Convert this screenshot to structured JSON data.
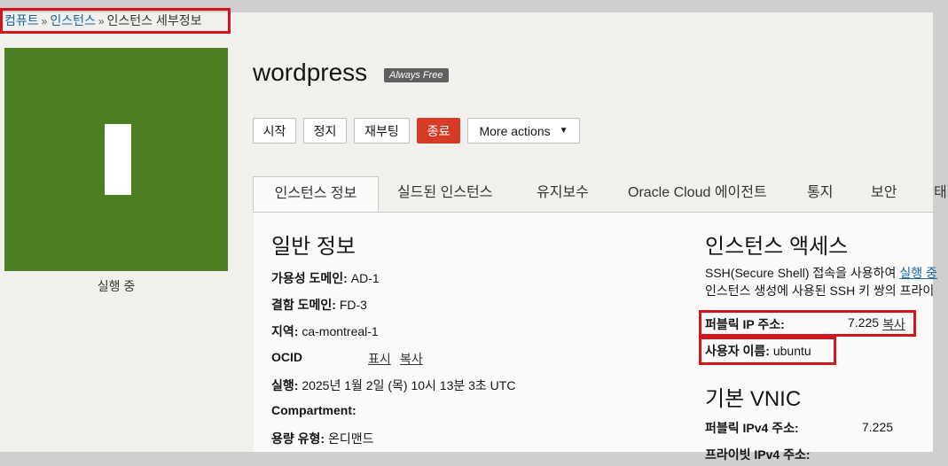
{
  "breadcrumb": {
    "compute": "컴퓨트",
    "instances": "인스턴스",
    "current": "인스턴스 세부정보",
    "separator": "»"
  },
  "status": {
    "letter": "I",
    "label": "실행 중",
    "color": "#4f7f24"
  },
  "instance": {
    "name": "wordpress",
    "badge": "Always Free"
  },
  "actions": {
    "start": "시작",
    "stop": "정지",
    "reboot": "재부팅",
    "terminate": "종료",
    "more": "More actions",
    "terminate_color": "#d63b25"
  },
  "tabs": [
    {
      "label": "인스턴스 정보",
      "active": true
    },
    {
      "label": "실드된 인스턴스",
      "active": false
    },
    {
      "label": "유지보수",
      "active": false
    },
    {
      "label": "Oracle Cloud 에이전트",
      "active": false
    },
    {
      "label": "통지",
      "active": false
    },
    {
      "label": "보안",
      "active": false
    },
    {
      "label": "태",
      "active": false
    }
  ],
  "general": {
    "heading": "일반 정보",
    "availability_domain_label": "가용성 도메인:",
    "availability_domain_value": "AD-1",
    "fault_domain_label": "결함 도메인:",
    "fault_domain_value": "FD-3",
    "region_label": "지역:",
    "region_value": "ca-montreal-1",
    "ocid_label": "OCID",
    "ocid_show": "표시",
    "ocid_copy": "복사",
    "launched_label": "실행:",
    "launched_value": "2025년 1월 2일 (목) 10시 13분 3초 UTC",
    "compartment_label": "Compartment:",
    "capacity_type_label": "용량 유형:",
    "capacity_type_value": "온디맨드"
  },
  "access": {
    "heading": "인스턴스 액세스",
    "description_line1": "SSH(Secure Shell) 접속을 사용하여",
    "description_link": "실행 중",
    "description_line2": "인스턴스 생성에 사용된 SSH 키 쌍의 프라이",
    "public_ip_label": "퍼블릭 IP 주소:",
    "public_ip_value": "7.225",
    "public_ip_copy": "복사",
    "username_label": "사용자 이름:",
    "username_value": "ubuntu"
  },
  "vnic": {
    "heading": "기본 VNIC",
    "public_ipv4_label": "퍼블릭 IPv4 주소:",
    "public_ipv4_value": "7.225",
    "private_ipv4_label": "프라이빗 IPv4 주소:"
  }
}
